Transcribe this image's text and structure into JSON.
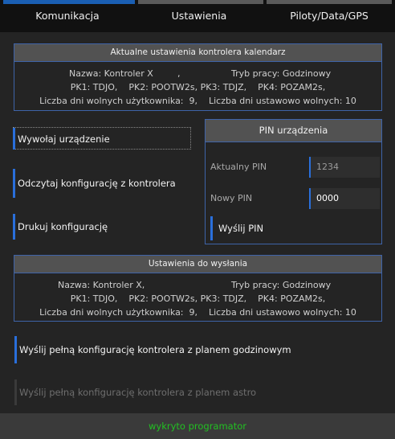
{
  "tabs": [
    {
      "label": "Komunikacja"
    },
    {
      "label": "Ustawienia"
    },
    {
      "label": "Piloty/Data/GPS"
    }
  ],
  "current_settings": {
    "header": "Aktualne ustawienia kontrolera kalendarz",
    "line1_name": "Nazwa: Kontroler X",
    "line1_sep": ",",
    "line1_mode": "Tryb pracy: Godzinowy",
    "line2": "PK1: TDJO,    PK2: POOTW2s, PK3: TDJZ,    PK4: POZAM2s,",
    "line3": "Liczba dni wolnych użytkownika:  9,    Liczba dni ustawowo wolnych: 10"
  },
  "actions": {
    "call_device": "Wywołaj urządzenie",
    "read_config": "Odczytaj konfigurację z kontrolera",
    "print_config": "Drukuj konfigurację"
  },
  "pin": {
    "header": "PIN urządzenia",
    "current_label": "Aktualny PIN",
    "current_value": "1234",
    "new_label": "Nowy PIN",
    "new_value": "0000",
    "send_label": "Wyślij PIN"
  },
  "settings_to_send": {
    "header": "Ustawienia do wysłania",
    "line1_name": "Nazwa: Kontroler X,",
    "line1_mode": "Tryb pracy: Godzinowy",
    "line2": "PK1: TDJO,    PK2: POOTW2s, PK3: TDJZ,    PK4: POZAM2s,",
    "line3": "Liczba dni wolnych użytkownika:  9,    Liczba dni ustawowo wolnych: 10"
  },
  "send_full_hourly": "Wyślij pełną konfigurację kontrolera z planem godzinowym",
  "send_full_astro": "Wyślij pełną konfigurację kontrolera z planem astro",
  "status": {
    "text": "wykryto programator",
    "color": "#22c022"
  },
  "colors": {
    "accent": "#2a6fdb",
    "panel_border": "#3e63a8",
    "background": "#242424"
  }
}
